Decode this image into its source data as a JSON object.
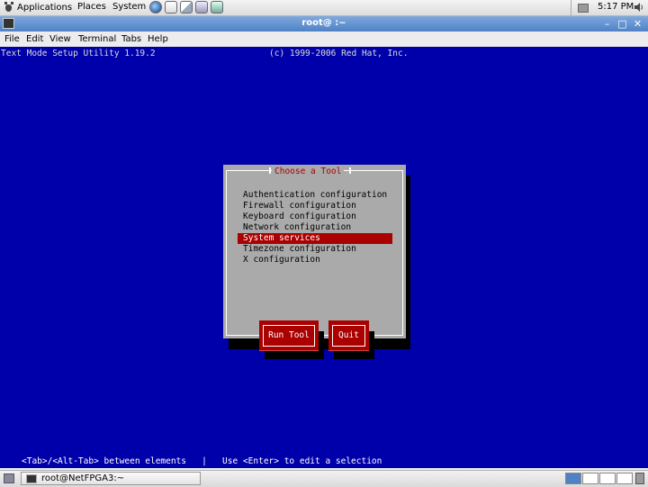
{
  "top_panel": {
    "applications": "Applications",
    "places": "Places",
    "system": "System",
    "clock": "5:17 PM"
  },
  "window": {
    "title": "root@                :~"
  },
  "menubar": {
    "file": "File",
    "edit": "Edit",
    "view": "View",
    "terminal": "Terminal",
    "tabs": "Tabs",
    "help": "Help"
  },
  "terminal": {
    "header_left": "Text Mode Setup Utility 1.19.2",
    "header_right": "(c) 1999-2006 Red Hat, Inc.",
    "status_line": "<Tab>/<Alt-Tab> between elements   |   Use <Enter> to edit a selection",
    "background_color": "#0000aa"
  },
  "dialog": {
    "title": "Choose a Tool",
    "items": [
      {
        "label": "Authentication configuration",
        "selected": false
      },
      {
        "label": "Firewall configuration",
        "selected": false
      },
      {
        "label": "Keyboard configuration",
        "selected": false
      },
      {
        "label": "Network configuration",
        "selected": false
      },
      {
        "label": "System services",
        "selected": true
      },
      {
        "label": "Timezone configuration",
        "selected": false
      },
      {
        "label": "X configuration",
        "selected": false
      }
    ],
    "run_tool_label": "Run Tool",
    "quit_label": "Quit",
    "accent_color": "#aa0000"
  },
  "taskbar": {
    "window_button": "root@NetFPGA3:~"
  }
}
